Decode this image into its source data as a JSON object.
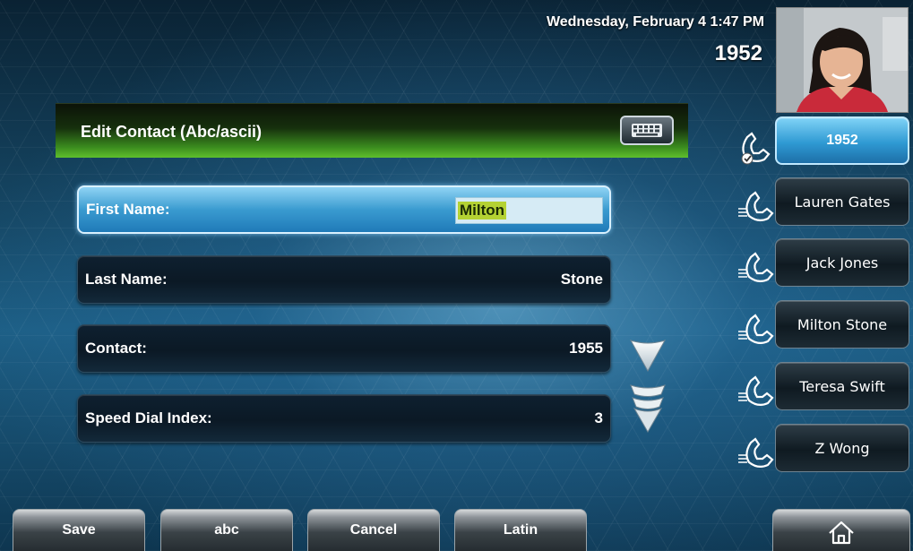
{
  "status": {
    "datetime": "Wednesday, February 4  1:47 PM",
    "line_number": "1952"
  },
  "title": "Edit Contact (Abc/ascii)",
  "fields": [
    {
      "label": "First Name:",
      "value": "Milton"
    },
    {
      "label": "Last Name:",
      "value": "Stone"
    },
    {
      "label": "Contact:",
      "value": "1955"
    },
    {
      "label": "Speed Dial Index:",
      "value": "3"
    }
  ],
  "line_keys": [
    {
      "label": "1952"
    },
    {
      "label": "Lauren Gates"
    },
    {
      "label": "Jack Jones"
    },
    {
      "label": "Milton Stone"
    },
    {
      "label": "Teresa Swift"
    },
    {
      "label": "Z Wong"
    }
  ],
  "softkeys": [
    {
      "label": "Save"
    },
    {
      "label": "abc"
    },
    {
      "label": "Cancel"
    },
    {
      "label": "Latin"
    }
  ],
  "icons": {
    "keyboard": "keyboard-icon",
    "handset": "handset-icon",
    "registered_check": "checkmark-icon",
    "scroll_down": "chevron-down-icon",
    "scroll_page_down": "double-chevron-down-icon",
    "home": "home-icon"
  },
  "colors": {
    "selection_highlight": "#b4d233",
    "selected_field": "#3a9bd0",
    "title_bar_green": "#3a8a1e"
  }
}
